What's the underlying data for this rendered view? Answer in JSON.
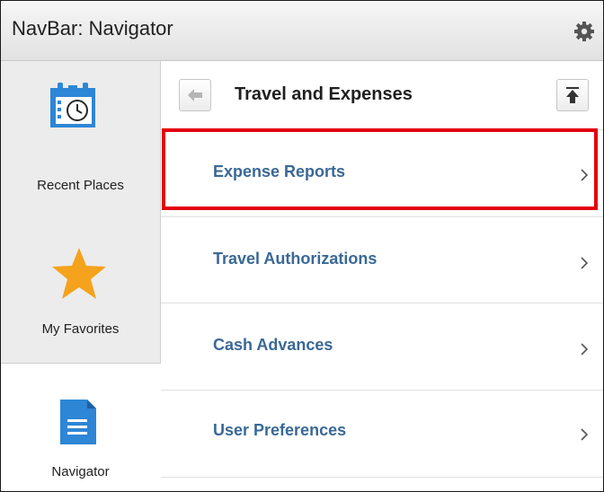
{
  "header": {
    "title": "NavBar: Navigator",
    "gear_icon": "gear-icon"
  },
  "sidebar": {
    "items": [
      {
        "label": "Recent Places",
        "icon": "calendar-clock-icon"
      },
      {
        "label": "My Favorites",
        "icon": "star-icon"
      },
      {
        "label": "Navigator",
        "icon": "document-icon"
      }
    ]
  },
  "main": {
    "title": "Travel and Expenses",
    "back_icon": "back-arrow-icon",
    "top_icon": "scroll-to-top-icon",
    "items": [
      {
        "label": "Expense Reports"
      },
      {
        "label": "Travel Authorizations"
      },
      {
        "label": "Cash Advances"
      },
      {
        "label": "User Preferences"
      }
    ]
  },
  "colors": {
    "link": "#3a6896",
    "highlight": "#e3000f",
    "icon_blue": "#2e86d6",
    "star": "#f5a21c"
  }
}
